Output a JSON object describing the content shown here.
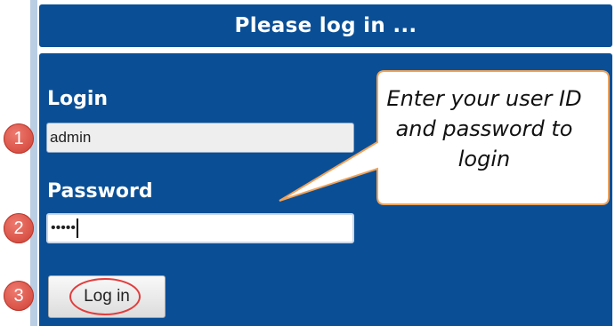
{
  "header": {
    "title": "Please log in ..."
  },
  "form": {
    "login_label": "Login",
    "login_value": "admin",
    "password_label": "Password",
    "password_value": "•••••",
    "submit_label": "Log in"
  },
  "steps": [
    "1",
    "2",
    "3"
  ],
  "callout": {
    "line1": "Enter your user ID",
    "line2": "and password to",
    "line3": "login"
  },
  "colors": {
    "panel": "#0a4f96",
    "badge": "#d9493e",
    "callout_border": "#f0a35a"
  }
}
